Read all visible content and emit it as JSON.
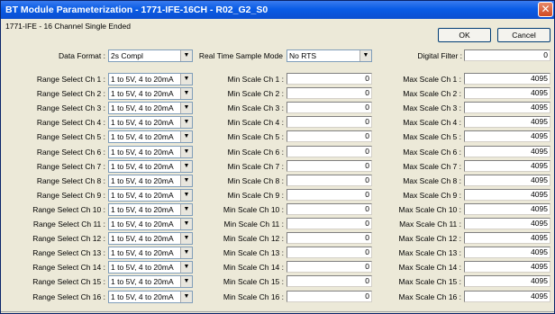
{
  "window": {
    "title": "BT Module Parameterization - 1771-IFE-16CH - R02_G2_S0",
    "subtitle": "1771-IFE - 16 Channel Single Ended",
    "close_glyph": "✕"
  },
  "buttons": {
    "ok": "OK",
    "cancel": "Cancel"
  },
  "top_row": {
    "data_format_label": "Data Format :",
    "data_format_value": "2s Compl",
    "sample_mode_label": "Real Time Sample Mode",
    "sample_mode_value": "No RTS",
    "digital_filter_label": "Digital Filter :",
    "digital_filter_value": "0"
  },
  "dropdown_glyph": "▼",
  "channels": [
    {
      "range_label": "Range Select Ch  1 :",
      "range_value": "1 to  5V,  4 to 20mA",
      "min_label": "Min Scale Ch  1 :",
      "min_value": "0",
      "max_label": "Max Scale Ch  1 :",
      "max_value": "4095"
    },
    {
      "range_label": "Range Select Ch  2 :",
      "range_value": "1 to  5V,  4 to 20mA",
      "min_label": "Min Scale Ch  2 :",
      "min_value": "0",
      "max_label": "Max Scale Ch  2 :",
      "max_value": "4095"
    },
    {
      "range_label": "Range Select Ch  3 :",
      "range_value": "1 to  5V,  4 to 20mA",
      "min_label": "Min Scale Ch  3 :",
      "min_value": "0",
      "max_label": "Max Scale Ch  3 :",
      "max_value": "4095"
    },
    {
      "range_label": "Range Select Ch  4 :",
      "range_value": "1 to  5V,  4 to 20mA",
      "min_label": "Min Scale Ch  4 :",
      "min_value": "0",
      "max_label": "Max Scale Ch  4 :",
      "max_value": "4095"
    },
    {
      "range_label": "Range Select Ch  5 :",
      "range_value": "1 to  5V,  4 to 20mA",
      "min_label": "Min Scale Ch  5 :",
      "min_value": "0",
      "max_label": "Max Scale Ch  5 :",
      "max_value": "4095"
    },
    {
      "range_label": "Range Select Ch  6 :",
      "range_value": "1 to  5V,  4 to 20mA",
      "min_label": "Min Scale Ch  6 :",
      "min_value": "0",
      "max_label": "Max Scale Ch  6 :",
      "max_value": "4095"
    },
    {
      "range_label": "Range Select Ch  7 :",
      "range_value": "1 to  5V,  4 to 20mA",
      "min_label": "Min Scale Ch  7 :",
      "min_value": "0",
      "max_label": "Max Scale Ch  7 :",
      "max_value": "4095"
    },
    {
      "range_label": "Range Select Ch  8 :",
      "range_value": "1 to  5V,  4 to 20mA",
      "min_label": "Min Scale Ch  8 :",
      "min_value": "0",
      "max_label": "Max Scale Ch  8 :",
      "max_value": "4095"
    },
    {
      "range_label": "Range Select Ch  9 :",
      "range_value": "1 to  5V,  4 to 20mA",
      "min_label": "Min Scale Ch  9 :",
      "min_value": "0",
      "max_label": "Max Scale Ch  9 :",
      "max_value": "4095"
    },
    {
      "range_label": "Range Select Ch 10 :",
      "range_value": "1 to  5V,  4 to 20mA",
      "min_label": "Min Scale Ch 10 :",
      "min_value": "0",
      "max_label": "Max Scale Ch 10 :",
      "max_value": "4095"
    },
    {
      "range_label": "Range Select Ch 11 :",
      "range_value": "1 to  5V,  4 to 20mA",
      "min_label": "Min Scale Ch 11 :",
      "min_value": "0",
      "max_label": "Max Scale Ch 11 :",
      "max_value": "4095"
    },
    {
      "range_label": "Range Select Ch 12 :",
      "range_value": "1 to  5V,  4 to 20mA",
      "min_label": "Min Scale Ch 12 :",
      "min_value": "0",
      "max_label": "Max Scale Ch 12 :",
      "max_value": "4095"
    },
    {
      "range_label": "Range Select Ch 13 :",
      "range_value": "1 to  5V,  4 to 20mA",
      "min_label": "Min Scale Ch 13 :",
      "min_value": "0",
      "max_label": "Max Scale Ch 13 :",
      "max_value": "4095"
    },
    {
      "range_label": "Range Select Ch 14 :",
      "range_value": "1 to  5V,  4 to 20mA",
      "min_label": "Min Scale Ch 14 :",
      "min_value": "0",
      "max_label": "Max Scale Ch 14 :",
      "max_value": "4095"
    },
    {
      "range_label": "Range Select Ch 15 :",
      "range_value": "1 to  5V,  4 to 20mA",
      "min_label": "Min Scale Ch 15 :",
      "min_value": "0",
      "max_label": "Max Scale Ch 15 :",
      "max_value": "4095"
    },
    {
      "range_label": "Range Select Ch 16 :",
      "range_value": "1 to  5V,  4 to 20mA",
      "min_label": "Min Scale Ch 16 :",
      "min_value": "0",
      "max_label": "Max Scale Ch 16 :",
      "max_value": "4095"
    }
  ]
}
